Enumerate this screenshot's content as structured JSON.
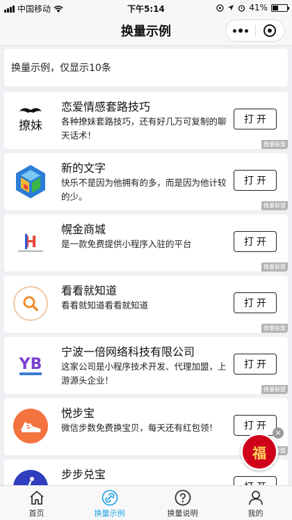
{
  "status_bar": {
    "carrier": "中国移动",
    "time": "下午5:14",
    "battery": "41%",
    "battery_level": 0.41
  },
  "nav": {
    "title": "换量示例"
  },
  "notice": {
    "text": "换量示例，仅显示10条"
  },
  "items": [
    {
      "title": "恋爱情感套路技巧",
      "desc": "各种撩妹套路技巧，还有好几万可复制的聊天话术！",
      "logo_text": "撩妹",
      "button": "打开",
      "tag": "微量联盟"
    },
    {
      "title": "新的文字",
      "desc": "快乐不是因为他拥有的多，而是因为他计较的少。",
      "logo_text": "",
      "button": "打开",
      "tag": "微量联盟"
    },
    {
      "title": "幌金商城",
      "desc": "是一款免费提供小程序入驻的平台",
      "logo_text": "H",
      "button": "打开",
      "tag": "微量联盟"
    },
    {
      "title": "看看就知道",
      "desc": "看看就知道看看就知道",
      "logo_text": "",
      "button": "打开",
      "tag": "微量联盟"
    },
    {
      "title": "宁波一倍网络科技有限公司",
      "desc": "这家公司是小程序技术开发、代理加盟，上游源头企业！",
      "logo_text": "YB",
      "button": "打开",
      "tag": "微量联盟"
    },
    {
      "title": "悦步宝",
      "desc": "微信步数免费换宝贝，每天还有红包领！",
      "logo_text": "",
      "button": "打开",
      "tag": "微量联盟"
    },
    {
      "title": "步步兑宝",
      "desc": "",
      "logo_text": "",
      "button": "打开",
      "tag": ""
    }
  ],
  "float_badge": {
    "text": "福"
  },
  "tabs": [
    {
      "label": "首页",
      "icon": "home-icon",
      "active": false
    },
    {
      "label": "换量示例",
      "icon": "link-icon",
      "active": true
    },
    {
      "label": "换量说明",
      "icon": "question-icon",
      "active": false
    },
    {
      "label": "我的",
      "icon": "user-icon",
      "active": false
    }
  ],
  "colors": {
    "accent": "#1aa3e8",
    "background": "#efeff4",
    "badge_red": "#d0021b"
  }
}
